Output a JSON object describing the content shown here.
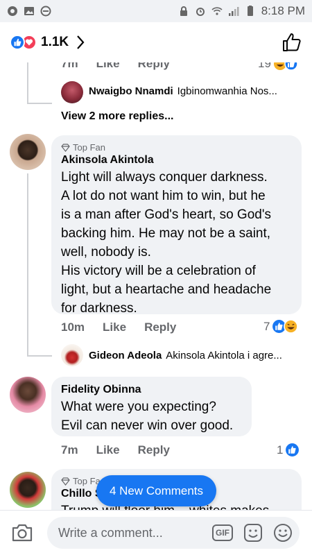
{
  "status_bar": {
    "time": "8:18 PM"
  },
  "header": {
    "reaction_count": "1.1K"
  },
  "comments": {
    "prev_meta": {
      "time": "7m",
      "like": "Like",
      "reply": "Reply",
      "count": "19"
    },
    "prev_reply": {
      "author": "Nwaigbo Nnamdi",
      "text": "Igbinomwanhia Nos..."
    },
    "view_more": "View 2 more replies...",
    "c1": {
      "badge": "Top Fan",
      "author": "Akinsola Akintola",
      "lines": [
        "Light will always conquer darkness.",
        "A lot do not want him to win, but he",
        "is a man after God's  heart, so God's",
        "backing him. He may not be a saint,",
        "well, nobody is.",
        "His victory will be a celebration of",
        "light, but a heartache and headache",
        "for darkness."
      ],
      "time": "10m",
      "like": "Like",
      "reply": "Reply",
      "count": "7",
      "reply_row": {
        "author": "Gideon Adeola",
        "text": "Akinsola Akintola i agre..."
      }
    },
    "c2": {
      "author": "Fidelity Obinna",
      "lines": [
        "What were you expecting?",
        "Evil can never win over good."
      ],
      "time": "7m",
      "like": "Like",
      "reply": "Reply",
      "count": "1"
    },
    "c3": {
      "badge": "Top Fa",
      "author": "Chillo S",
      "partial_text": "Trump will floor him... whites makes"
    }
  },
  "new_comments_label": "4 New Comments",
  "composer": {
    "placeholder": "Write a comment...",
    "gif_label": "GIF"
  },
  "colors": {
    "accent": "#1877f2",
    "love": "#f33e58",
    "haha": "#f7b125"
  }
}
